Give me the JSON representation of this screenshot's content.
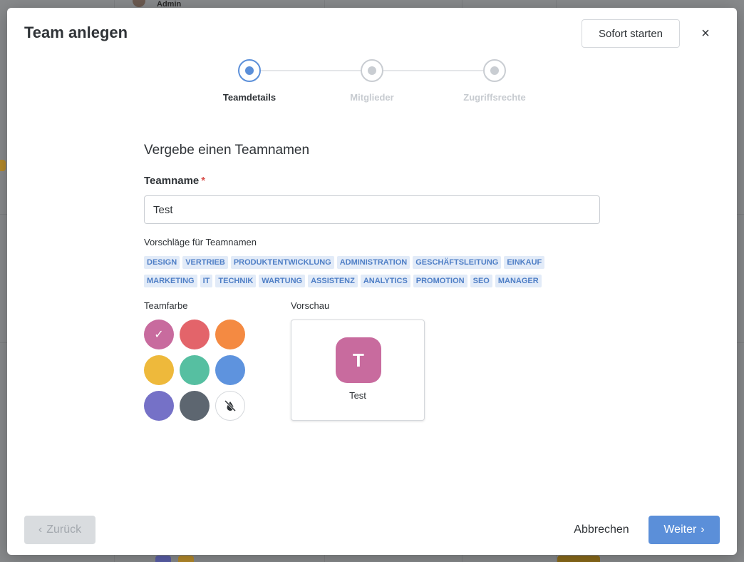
{
  "modal": {
    "title": "Team anlegen",
    "start_now_label": "Sofort starten",
    "close_glyph": "×"
  },
  "stepper": {
    "steps": [
      {
        "label": "Teamdetails",
        "active": true
      },
      {
        "label": "Mitglieder",
        "active": false
      },
      {
        "label": "Zugriffsrechte",
        "active": false
      }
    ]
  },
  "form": {
    "section_title": "Vergebe einen Teamnamen",
    "name_label": "Teamname",
    "required_marker": "*",
    "name_value": "Test",
    "suggestions_label": "Vorschläge für Teamnamen",
    "suggestions_row1": [
      "DESIGN",
      "VERTRIEB",
      "PRODUKTENTWICKLUNG",
      "ADMINISTRATION",
      "GESCHÄFTSLEITUNG",
      "EINKAUF"
    ],
    "suggestions_row2": [
      "MARKETING",
      "IT",
      "TECHNIK",
      "WARTUNG",
      "ASSISTENZ",
      "ANALYTICS",
      "PROMOTION",
      "SEO",
      "MANAGER"
    ],
    "color_label": "Teamfarbe",
    "preview_label": "Vorschau",
    "colors": [
      "#c86b9e",
      "#e3646a",
      "#f48a42",
      "#eeb93b",
      "#56bfa1",
      "#5e93de",
      "#7571c7",
      "#5d6670",
      "none"
    ],
    "selected_color_index": 0,
    "check_glyph": "✓"
  },
  "preview": {
    "initial": "T",
    "name": "Test"
  },
  "footer": {
    "back_label": "Zurück",
    "cancel_label": "Abbrechen",
    "next_label": "Weiter"
  },
  "background": {
    "header_text": "Admin"
  }
}
